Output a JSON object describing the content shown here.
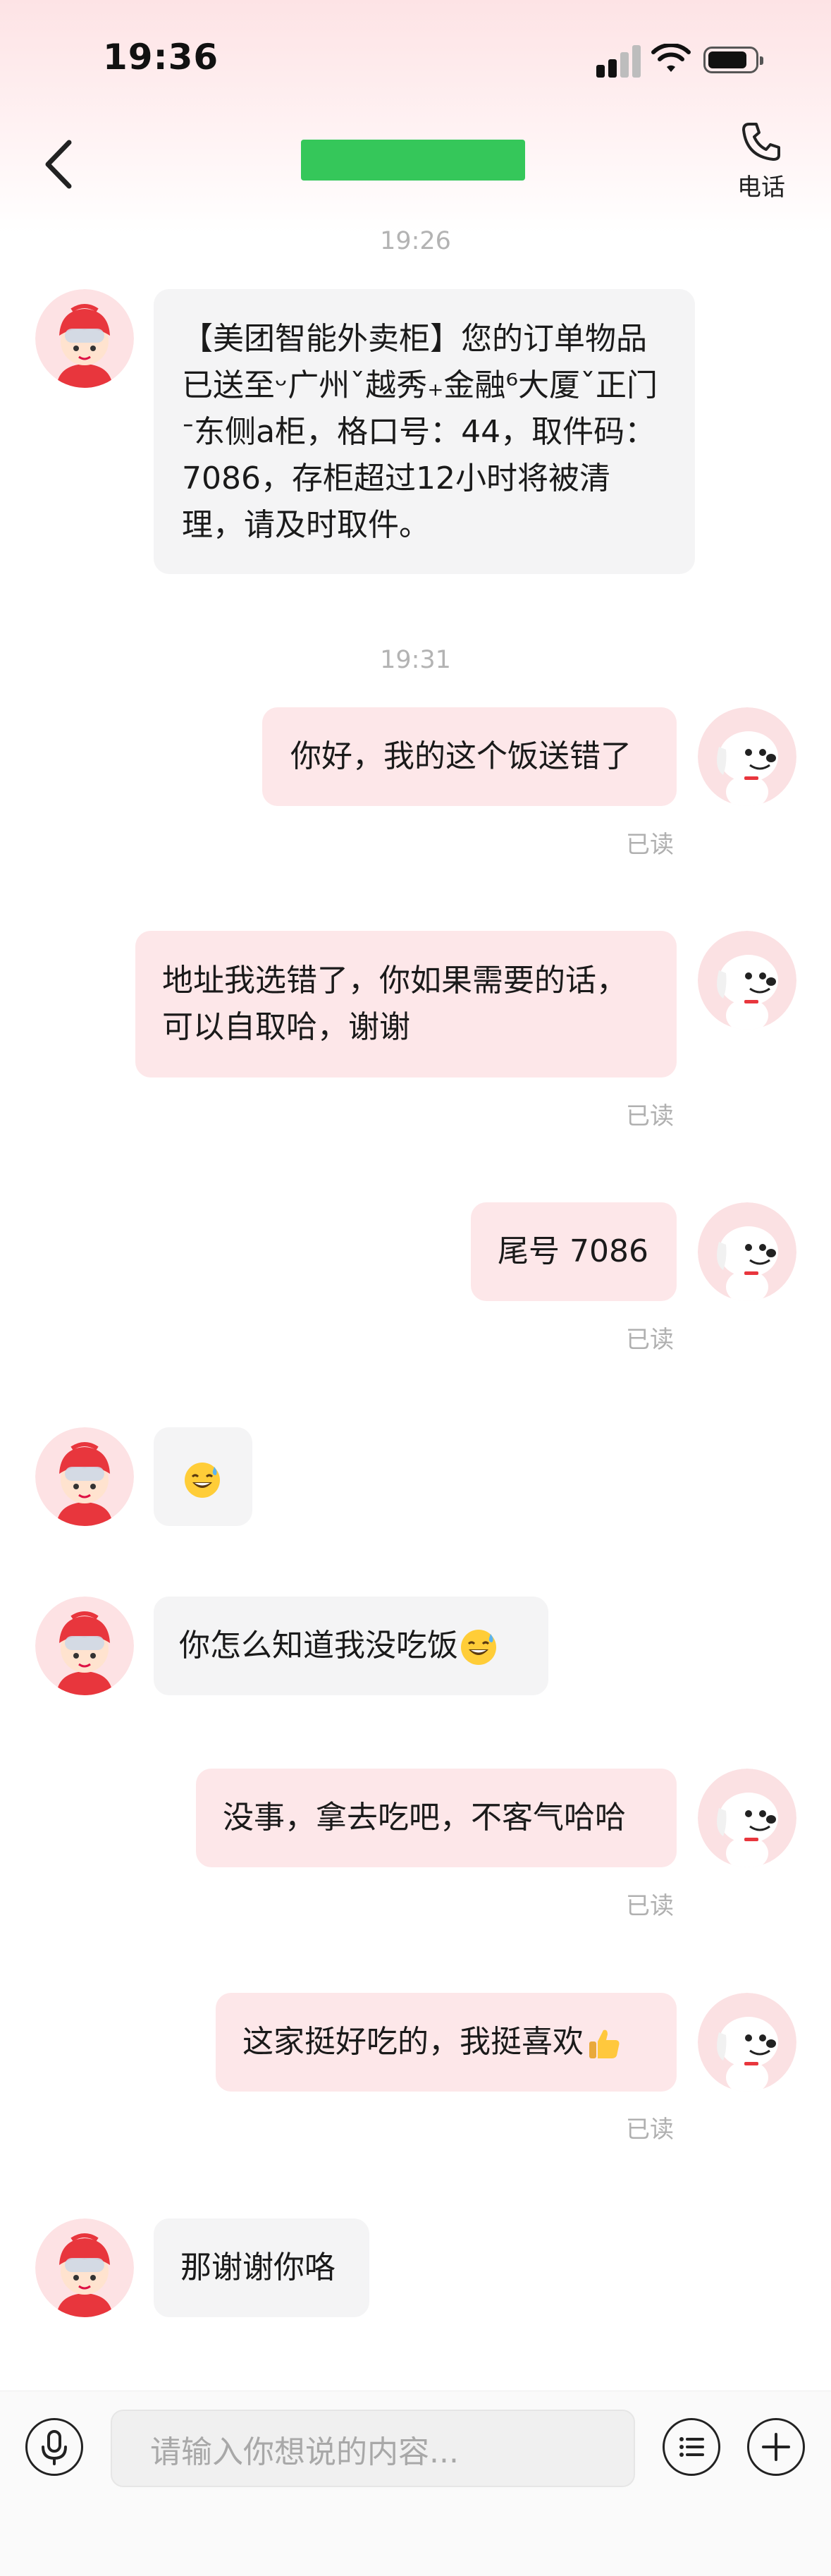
{
  "status_bar": {
    "time": "19:36"
  },
  "header": {
    "phone_label": "电话"
  },
  "timestamps": [
    "19:26",
    "19:31"
  ],
  "messages": [
    {
      "side": "in",
      "text": "【美团智能外卖柜】您的订单物品已送至ᵕ广州ˇ越秀₊金融⁶大厦ˇ正门ᐨ东侧a柜，格口号：44，取件码：7086，存柜超过12小时将被清理，请及时取件。"
    },
    {
      "side": "out",
      "text": "你好，我的这个饭送错了",
      "status": "已读"
    },
    {
      "side": "out",
      "text": "地址我选错了，你如果需要的话，可以自取哈，谢谢",
      "status": "已读"
    },
    {
      "side": "out",
      "text": "尾号 7086",
      "status": "已读"
    },
    {
      "side": "in",
      "text": "",
      "emoji": "sweat-smile-emoji"
    },
    {
      "side": "in",
      "text": "你怎么知道我没吃饭",
      "emoji": "sweat-smile-emoji"
    },
    {
      "side": "out",
      "text": "没事，拿去吃吧，不客气哈哈",
      "status": "已读"
    },
    {
      "side": "out",
      "text": "这家挺好吃的，我挺喜欢",
      "emoji": "thumbs-up-emoji",
      "status": "已读"
    },
    {
      "side": "in",
      "text": "那谢谢你咯"
    }
  ],
  "input": {
    "placeholder": "请输入你想说的内容..."
  },
  "colors": {
    "accent_green": "#35c75a",
    "out_bubble": "#fde7e9",
    "in_bubble": "#f4f4f5"
  },
  "icons": [
    "back-chevron-icon",
    "phone-icon",
    "microphone-icon",
    "list-icon",
    "plus-icon"
  ]
}
